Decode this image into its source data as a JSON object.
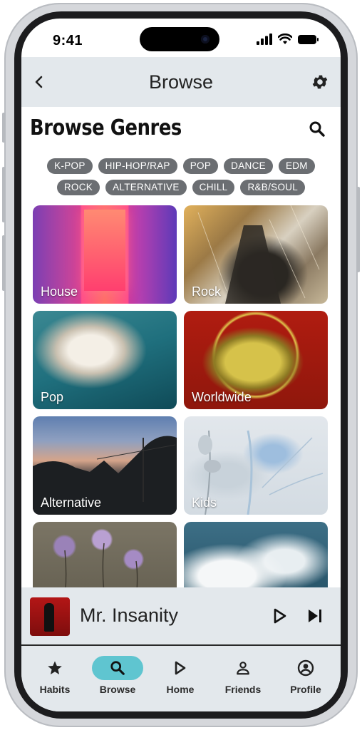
{
  "status_bar": {
    "time": "9:41"
  },
  "header": {
    "title": "Browse"
  },
  "page": {
    "heading": "Browse Genres"
  },
  "chips": {
    "row1": [
      "K-POP",
      "HIP-HOP/RAP",
      "POP",
      "DANCE",
      "EDM"
    ],
    "row2": [
      "ROCK",
      "ALTERNATIVE",
      "CHILL",
      "R&B/SOUL"
    ]
  },
  "genres": [
    {
      "label": "House"
    },
    {
      "label": "Rock"
    },
    {
      "label": "Pop"
    },
    {
      "label": "Worldwide"
    },
    {
      "label": "Alternative"
    },
    {
      "label": "Kids"
    },
    {
      "label": ""
    },
    {
      "label": ""
    }
  ],
  "player": {
    "track_title": "Mr. Insanity"
  },
  "tabs": [
    {
      "label": "Habits",
      "icon": "star-icon"
    },
    {
      "label": "Browse",
      "icon": "search-icon"
    },
    {
      "label": "Home",
      "icon": "play-icon"
    },
    {
      "label": "Friends",
      "icon": "person-icon"
    },
    {
      "label": "Profile",
      "icon": "profile-circle-icon"
    }
  ],
  "colors": {
    "header_bg": "#e3e8ec",
    "chip_bg": "#6b6e72",
    "active_tab_pill": "#5fc5d0"
  }
}
